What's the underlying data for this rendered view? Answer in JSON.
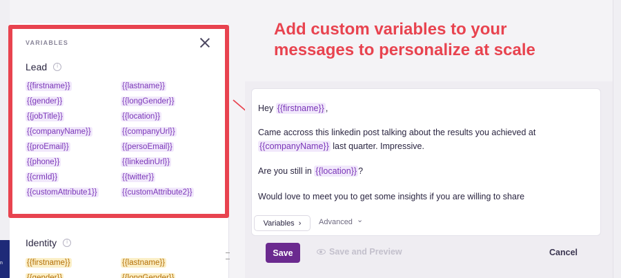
{
  "headline": {
    "line1": "Add custom variables to your",
    "line2": "messages to personalize at scale"
  },
  "variables_panel": {
    "title": "VARIABLES",
    "lead": {
      "label": "Lead",
      "left": [
        "{{firstname}}",
        "{{gender}}",
        "{{jobTitle}}",
        "{{companyName}}",
        "{{proEmail}}",
        "{{phone}}",
        "{{crmId}}",
        "{{customAttribute1}}"
      ],
      "right": [
        "{{lastname}}",
        "{{longGender}}",
        "{{location}}",
        "{{companyUrl}}",
        "{{persoEmail}}",
        "{{linkedinUrl}}",
        "{{twitter}}",
        "{{customAttribute2}}"
      ]
    },
    "identity": {
      "label": "Identity",
      "left": [
        "{{firstname}}",
        "{{gender}}"
      ],
      "right": [
        "{{lastname}}",
        "{{longGender}}"
      ]
    }
  },
  "message": {
    "greeting": "Hey ",
    "greeting_var": "{{firstname}}",
    "greeting_end": ",",
    "p2_line1": "Came accross this linkedin post talking about the results you achieved at",
    "p2_var": "{{companyName}}",
    "p2_rest": " last quarter. Impressive.",
    "p3_start": "Are you still in ",
    "p3_var": "{{location}}",
    "p3_end": "?",
    "p4": "Would love to meet you to get some insights if you are willing to share"
  },
  "editor_toolbar": {
    "variables_label": "Variables",
    "variables_chevron": "›",
    "advanced_label": "Advanced",
    "advanced_chevron": "⌄"
  },
  "actions": {
    "save": "Save",
    "save_preview": "Save and Preview",
    "cancel": "Cancel"
  },
  "left_sidebar": {
    "badge_text": "n"
  },
  "colors": {
    "highlight": "#e8434f",
    "lead_chip_text": "#7a35b8",
    "lead_chip_bg": "#f1e8fb",
    "identity_chip_text": "#b46f07",
    "identity_chip_bg": "#fbefc7",
    "save_button": "#6b2a8f"
  },
  "icons": [
    "close-icon",
    "info-icon",
    "eye-icon",
    "chevron-right-icon",
    "chevron-down-icon"
  ]
}
